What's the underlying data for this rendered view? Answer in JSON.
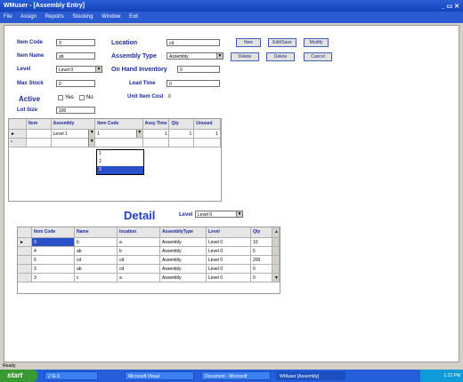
{
  "window": {
    "title": "WMuser - [Assembly Entry]"
  },
  "menu": [
    "File",
    "Assign",
    "Reports",
    "Stocking",
    "Window",
    "Exit"
  ],
  "form": {
    "item_code": {
      "label": "Item Code",
      "value": "3"
    },
    "item_name": {
      "label": "Item Name",
      "value": "ab"
    },
    "level": {
      "label": "Level",
      "value": "Level 0"
    },
    "max_stock": {
      "label": "Max Stock",
      "value": "0"
    },
    "active": {
      "label": "Active",
      "yes": "Yes",
      "no": "No"
    },
    "lot_size": {
      "label": "Lot Size",
      "value": "100"
    },
    "location": {
      "label": "Location",
      "value": "cd"
    },
    "assembly_type": {
      "label": "Assembly Type",
      "value": "Assembly"
    },
    "on_hand": {
      "label": "On Hand Inventory",
      "value": "0"
    },
    "lead_time": {
      "label": "Lead Time",
      "value": "0"
    },
    "unit_cost": {
      "label": "Unit Item Cost",
      "value": "0"
    }
  },
  "buttons": [
    "New",
    "Edit/Save",
    "Modify",
    "Delete",
    "Delete",
    "Cancel"
  ],
  "component_grid": {
    "columns": [
      "Item",
      "Assembly",
      "Item Code",
      "Assy Time",
      "Qty",
      "Unused"
    ],
    "rows": [
      [
        "",
        "Level 1",
        "1",
        "1",
        "1",
        "1"
      ],
      [
        "",
        "",
        "",
        "",
        "",
        ""
      ]
    ],
    "dropdown_options": [
      "1",
      "2",
      "3"
    ]
  },
  "detail": {
    "title": "Detail",
    "level_label": "Level",
    "level_value": "Level 0"
  },
  "detail_grid": {
    "columns": [
      "Item Code",
      "Name",
      "location",
      "AssemblyType",
      "Level",
      "Qty"
    ],
    "rows": [
      [
        "3",
        "b",
        "a",
        "Assembly",
        "Level 0",
        "10"
      ],
      [
        "4",
        "ab",
        "b",
        "Assembly",
        "Level 0",
        "5"
      ],
      [
        "5",
        "cd",
        "cd",
        "Assembly",
        "Level 0",
        "200"
      ],
      [
        "3",
        "ab",
        "cd",
        "Assembly",
        "Level 0",
        "0"
      ],
      [
        "3",
        "c",
        "a",
        "Assembly",
        "Level 0",
        "0"
      ]
    ]
  },
  "status": {
    "text": "Ready"
  },
  "taskbar": {
    "start": "start",
    "items": [
      "2 IE 6",
      "Microsoft Visual",
      "Document - Microsoft",
      "WMuser [Assembly]"
    ],
    "clock": "1:22 PM"
  }
}
